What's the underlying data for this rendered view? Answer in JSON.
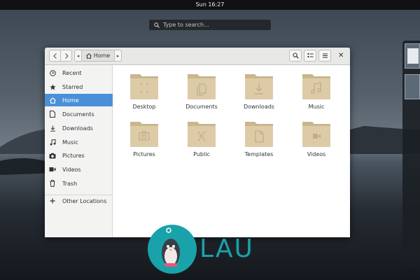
{
  "topbar": {
    "clock": "Sun 16:27"
  },
  "search": {
    "placeholder": "Type to search..."
  },
  "window": {
    "pathbar": {
      "home_label": "Home"
    },
    "close_glyph": "✕"
  },
  "sidebar": {
    "items": [
      {
        "label": "Recent",
        "icon": "clock-icon"
      },
      {
        "label": "Starred",
        "icon": "star-icon"
      },
      {
        "label": "Home",
        "icon": "home-icon",
        "active": true
      },
      {
        "label": "Documents",
        "icon": "document-icon"
      },
      {
        "label": "Downloads",
        "icon": "download-icon"
      },
      {
        "label": "Music",
        "icon": "music-icon"
      },
      {
        "label": "Pictures",
        "icon": "camera-icon"
      },
      {
        "label": "Videos",
        "icon": "video-icon"
      },
      {
        "label": "Trash",
        "icon": "trash-icon"
      },
      {
        "label": "Other Locations",
        "icon": "plus-icon"
      }
    ]
  },
  "folders": [
    {
      "label": "Desktop",
      "emblem": "desktop"
    },
    {
      "label": "Documents",
      "emblem": "documents"
    },
    {
      "label": "Downloads",
      "emblem": "downloads"
    },
    {
      "label": "Music",
      "emblem": "music"
    },
    {
      "label": "Pictures",
      "emblem": "pictures"
    },
    {
      "label": "Public",
      "emblem": "public"
    },
    {
      "label": "Templates",
      "emblem": "templates"
    },
    {
      "label": "Videos",
      "emblem": "videos"
    }
  ],
  "watermark": {
    "text": "LAU"
  },
  "colors": {
    "accent": "#4a90d9",
    "folder": "#dccba6",
    "watermark": "#19a2a9"
  }
}
